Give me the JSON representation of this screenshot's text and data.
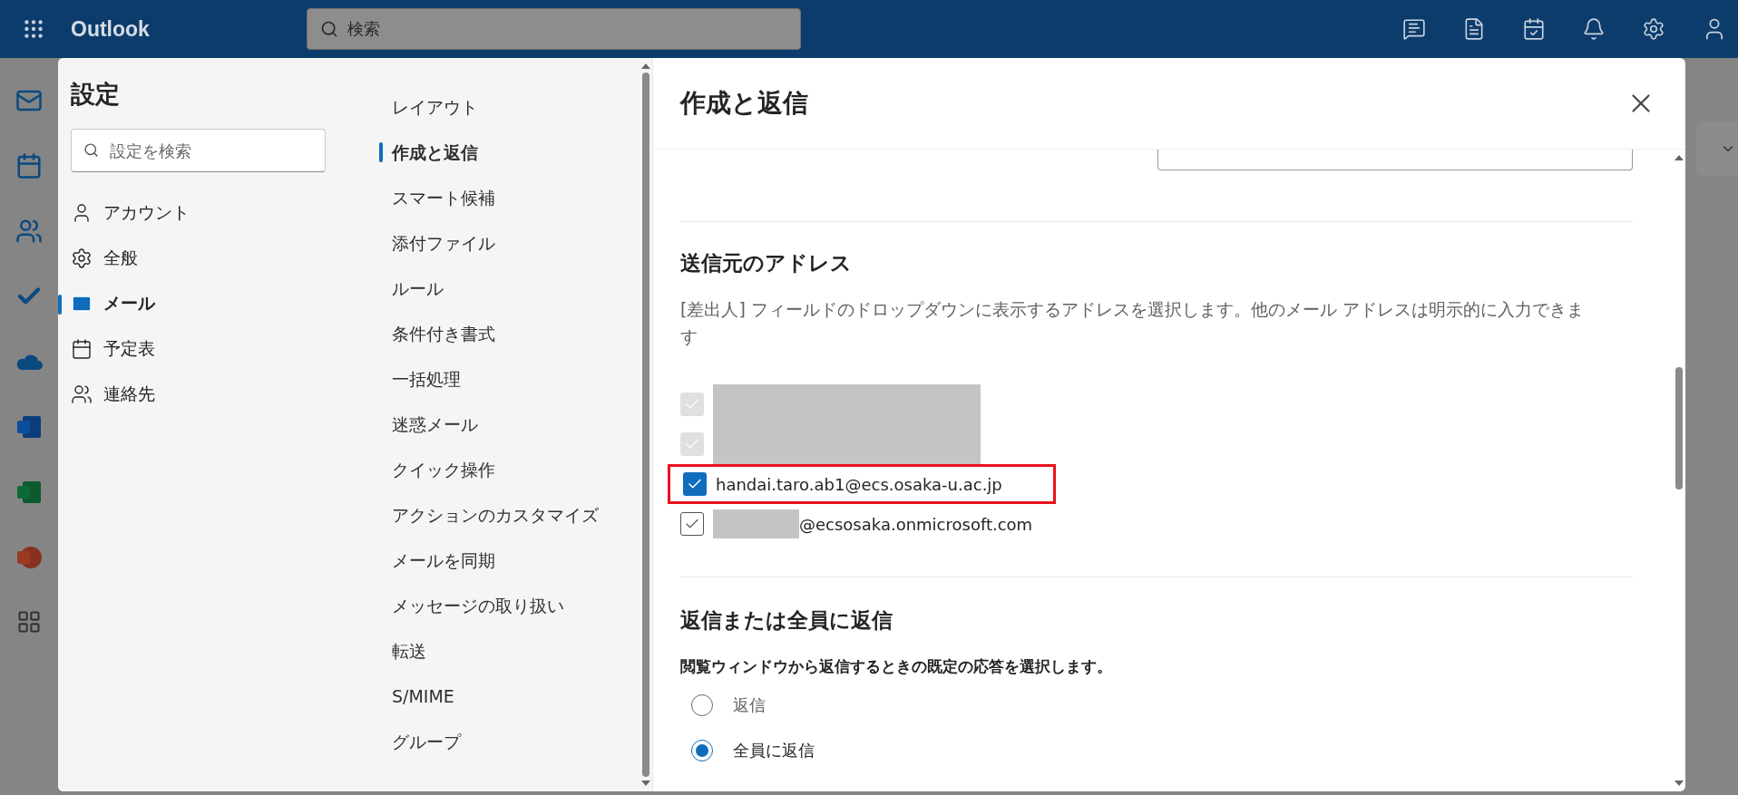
{
  "top_bar": {
    "app_name": "Outlook",
    "search": {
      "placeholder": "検索"
    }
  },
  "settings": {
    "title": "設定",
    "search": {
      "placeholder": "設定を検索"
    },
    "categories": [
      {
        "label": "アカウント",
        "selected": false
      },
      {
        "label": "全般",
        "selected": false
      },
      {
        "label": "メール",
        "selected": true
      },
      {
        "label": "予定表",
        "selected": false
      },
      {
        "label": "連絡先",
        "selected": false
      }
    ],
    "subcategories": [
      {
        "label": "レイアウト",
        "selected": false
      },
      {
        "label": "作成と返信",
        "selected": true
      },
      {
        "label": "スマート候補",
        "selected": false
      },
      {
        "label": "添付ファイル",
        "selected": false
      },
      {
        "label": "ルール",
        "selected": false
      },
      {
        "label": "条件付き書式",
        "selected": false
      },
      {
        "label": "一括処理",
        "selected": false
      },
      {
        "label": "迷惑メール",
        "selected": false
      },
      {
        "label": "クイック操作",
        "selected": false
      },
      {
        "label": "アクションのカスタマイズ",
        "selected": false
      },
      {
        "label": "メールを同期",
        "selected": false
      },
      {
        "label": "メッセージの取り扱い",
        "selected": false
      },
      {
        "label": "転送",
        "selected": false
      },
      {
        "label": "S/MIME",
        "selected": false
      },
      {
        "label": "グループ",
        "selected": false
      }
    ]
  },
  "content": {
    "title": "作成と返信",
    "from_addresses": {
      "heading": "送信元のアドレス",
      "description": "[差出人] フィールドのドロップダウンに表示するアドレスを選択します。他のメール アドレスは明示的に入力できます",
      "addresses": [
        {
          "kind": "greyed",
          "redacted": true,
          "highlighted": false
        },
        {
          "kind": "greyed",
          "redacted": true,
          "highlighted": false
        },
        {
          "kind": "filled",
          "redacted": false,
          "highlighted": true,
          "text": "handai.taro.ab1@ecs.osaka-u.ac.jp"
        },
        {
          "kind": "outline",
          "redacted": true,
          "highlighted": false,
          "text": "@ecsosaka.onmicrosoft.com"
        }
      ]
    },
    "reply": {
      "heading": "返信または全員に返信",
      "question": "閲覧ウィンドウから返信するときの既定の応答を選択します。",
      "options": [
        {
          "label": "返信",
          "selected": false
        },
        {
          "label": "全員に返信",
          "selected": true
        }
      ]
    }
  }
}
